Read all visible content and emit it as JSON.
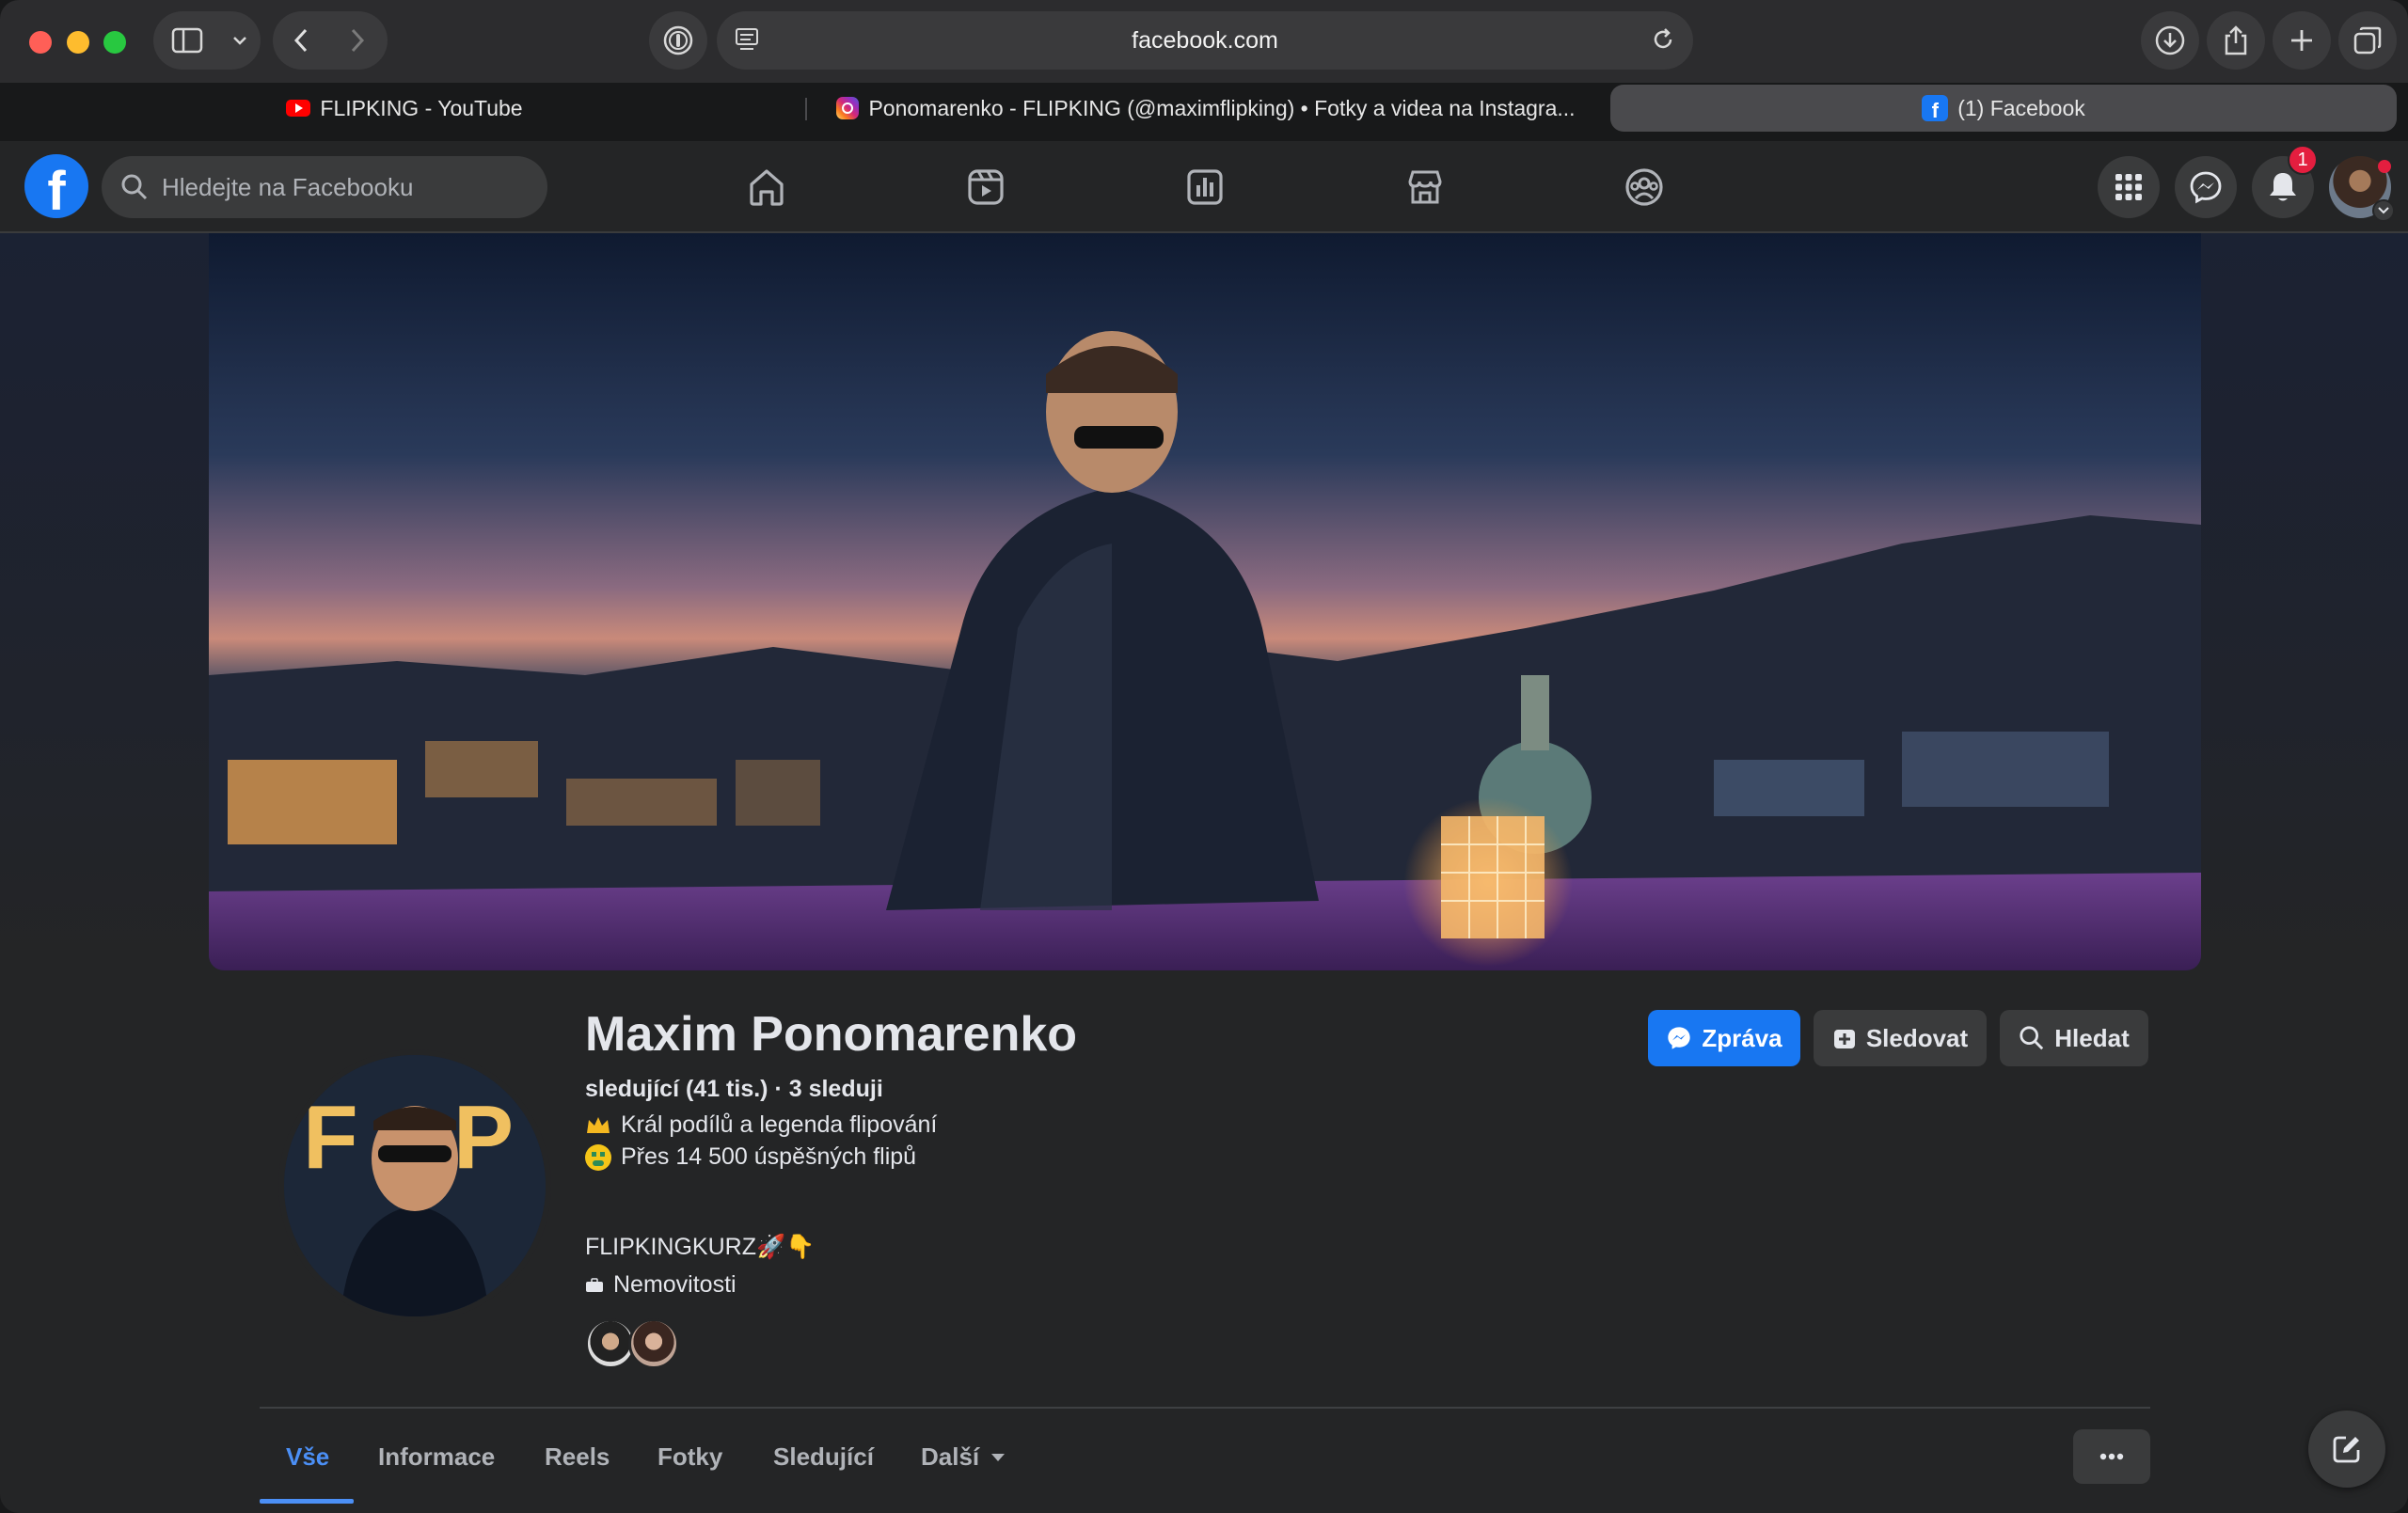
{
  "browser": {
    "url": "facebook.com",
    "tabs": [
      {
        "title": "FLIPKING - YouTube",
        "favicon": "youtube-icon"
      },
      {
        "title": "Ponomarenko - FLIPKING (@maximflipking) • Fotky a videa na Instagra...",
        "favicon": "instagram-icon"
      },
      {
        "title": "(1) Facebook",
        "favicon": "facebook-icon",
        "active": true
      }
    ]
  },
  "fb_nav": {
    "search_placeholder": "Hledejte na Facebooku",
    "notifications_count": "1",
    "icons": [
      "home-icon",
      "video-icon",
      "feeds-icon",
      "marketplace-icon",
      "groups-icon"
    ]
  },
  "profile": {
    "name": "Maxim Ponomarenko",
    "followers_line": "sledující (41 tis.) · 3 sleduji",
    "bio_line1": "Král podílů a legenda flipování",
    "bio_line2": "Přes 14 500 úspěšných flipů",
    "link_line": "FLIPKINGKURZ🚀👇",
    "category": "Nemovitosti"
  },
  "actions": {
    "message": "Zpráva",
    "follow": "Sledovat",
    "search": "Hledat"
  },
  "tabs": [
    "Vše",
    "Informace",
    "Reels",
    "Fotky",
    "Sledující",
    "Další"
  ],
  "colors": {
    "accent": "#1877f2",
    "active_tab": "#4b8ff5",
    "badge": "#e41e3f"
  }
}
